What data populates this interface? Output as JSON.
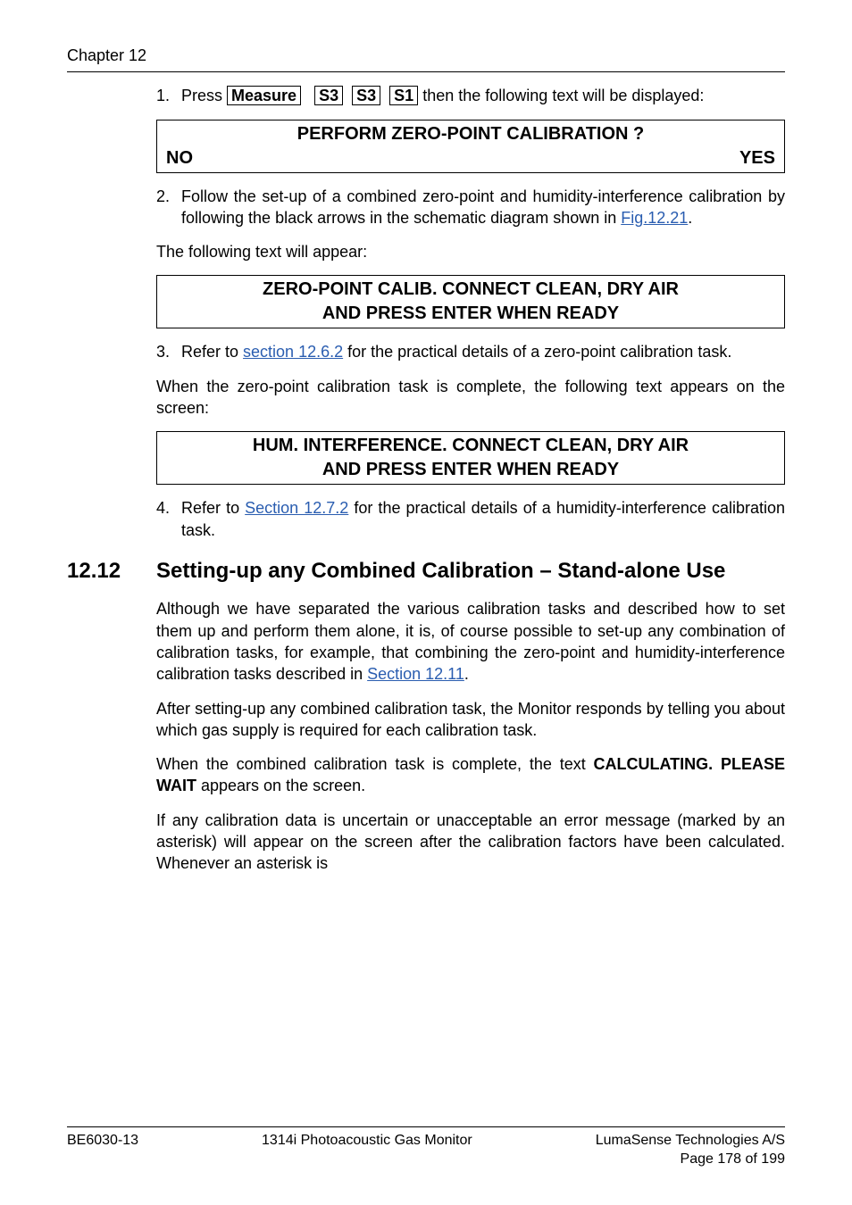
{
  "header": {
    "chapter": "Chapter 12"
  },
  "steps": {
    "s1": {
      "num": "1.",
      "pre": "Press ",
      "keys": [
        "Measure",
        "S3",
        "S3",
        "S1"
      ],
      "post": " then the following text will be displayed:"
    },
    "s2": {
      "num": "2.",
      "text_a": "Follow the set-up of a combined zero-point and humidity-interference calibration by following the black arrows in the schematic diagram shown in ",
      "link": "Fig.12.21",
      "text_b": "."
    },
    "s3": {
      "num": "3.",
      "text_a": "Refer to ",
      "link": "section 12.6.2",
      "text_b": " for the practical details of a zero-point calibration task."
    },
    "s4": {
      "num": "4.",
      "text_a": "Refer to ",
      "link": "Section 12.7.2",
      "text_b": " for the practical details of a humidity-interference calibration task."
    }
  },
  "display1": {
    "line1": "PERFORM ZERO-POINT CALIBRATION ?",
    "no": "NO",
    "yes": "YES"
  },
  "display2": {
    "line1": "ZERO-POINT CALIB. CONNECT CLEAN, DRY AIR",
    "line2": "AND PRESS ENTER WHEN READY"
  },
  "display3": {
    "line1": "HUM. INTERFERENCE. CONNECT CLEAN, DRY AIR",
    "line2": "AND PRESS ENTER WHEN READY"
  },
  "plain": {
    "p1": "The following text will appear:",
    "p2": "When the zero-point calibration task is complete, the following text appears on the screen:"
  },
  "section": {
    "num": "12.12",
    "title": "Setting-up any Combined Calibration – Stand-alone Use"
  },
  "body": {
    "b1a": "Although we have separated the various calibration tasks and described how to set them up and perform them alone, it is, of course possible to set-up any combination of calibration tasks, for example, that combining the zero-point and humidity-interference calibration tasks described in ",
    "b1link": "Section 12.11",
    "b1b": ".",
    "b2": "After setting-up any combined calibration task, the Monitor responds by telling you about which gas supply is required for each calibration task.",
    "b3a": "When the combined calibration task is complete, the text ",
    "b3bold": "CALCULATING. PLEASE WAIT",
    "b3b": " appears on the screen.",
    "b4": "If any calibration data is uncertain or unacceptable an error message (marked by an asterisk) will appear on the screen after the calibration factors have been calculated. Whenever an asterisk is"
  },
  "footer": {
    "left": "BE6030-13",
    "center": "1314i Photoacoustic Gas Monitor",
    "right1": "LumaSense Technologies A/S",
    "right2": "Page 178 of 199"
  }
}
